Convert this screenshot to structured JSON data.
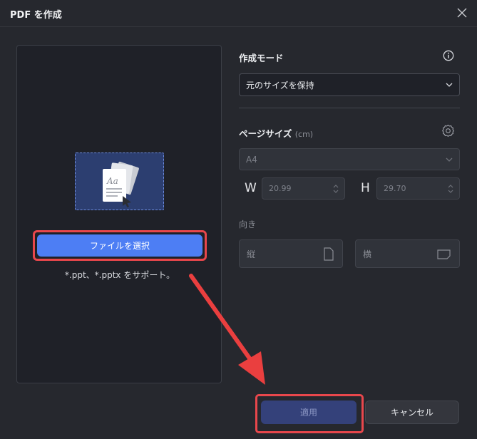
{
  "dialog": {
    "title": "PDF を作成",
    "close_icon": "close-icon"
  },
  "left_panel": {
    "drop_zone_icon": "documents-icon",
    "select_file_label": "ファイルを選択",
    "support_text": "*.ppt、*.pptx をサポート。"
  },
  "mode": {
    "label": "作成モード",
    "info_icon": "info-icon",
    "selected": "元のサイズを保持"
  },
  "page_size": {
    "label": "ページサイズ",
    "unit": "(cm)",
    "settings_icon": "gear-icon",
    "selected": "A4",
    "width_label": "W",
    "width_value": "20.99",
    "height_label": "H",
    "height_value": "29.70"
  },
  "orientation": {
    "label": "向き",
    "portrait_label": "縦",
    "landscape_label": "横"
  },
  "footer": {
    "apply_label": "適用",
    "cancel_label": "キャンセル"
  },
  "colors": {
    "accent": "#4d7ef4",
    "highlight": "#e8474c",
    "background": "#26282e"
  }
}
